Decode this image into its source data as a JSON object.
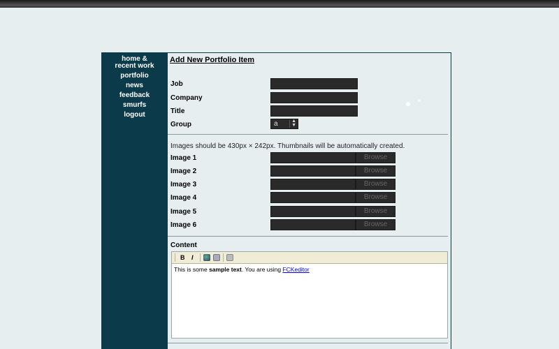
{
  "sidebar": {
    "items": [
      {
        "label": "home &"
      },
      {
        "label": "recent work"
      },
      {
        "label": "portfolio"
      },
      {
        "label": "news"
      },
      {
        "label": "feedback"
      },
      {
        "label": "smurfs"
      },
      {
        "label": "logout"
      }
    ]
  },
  "page": {
    "title": "Add New Portfolio Item"
  },
  "form": {
    "job_label": "Job",
    "company_label": "Company",
    "title_label": "Title",
    "group_label": "Group",
    "group_value": "a",
    "images_note": "Images should be 430px × 242px. Thumbnails will be automatically created.",
    "images": [
      {
        "label": "Image 1",
        "browse": "Browse"
      },
      {
        "label": "Image 2",
        "browse": "Browse"
      },
      {
        "label": "Image 3",
        "browse": "Browse"
      },
      {
        "label": "Image 4",
        "browse": "Browse"
      },
      {
        "label": "Image 5",
        "browse": "Browse"
      },
      {
        "label": "Image 6",
        "browse": "Browse"
      }
    ],
    "content_label": "Content"
  },
  "editor": {
    "bold_btn": "B",
    "italic_btn": "I",
    "text_prefix": "This is some ",
    "text_bold": "sample text",
    "text_mid": ". You are using ",
    "link_text": "FCKeditor"
  },
  "colors": {
    "sidebar_bg": "#0b3a4b",
    "page_bg": "#e6eef0",
    "input_bg": "#2a2a2a",
    "toolbar_bg": "#f1ecd6"
  }
}
